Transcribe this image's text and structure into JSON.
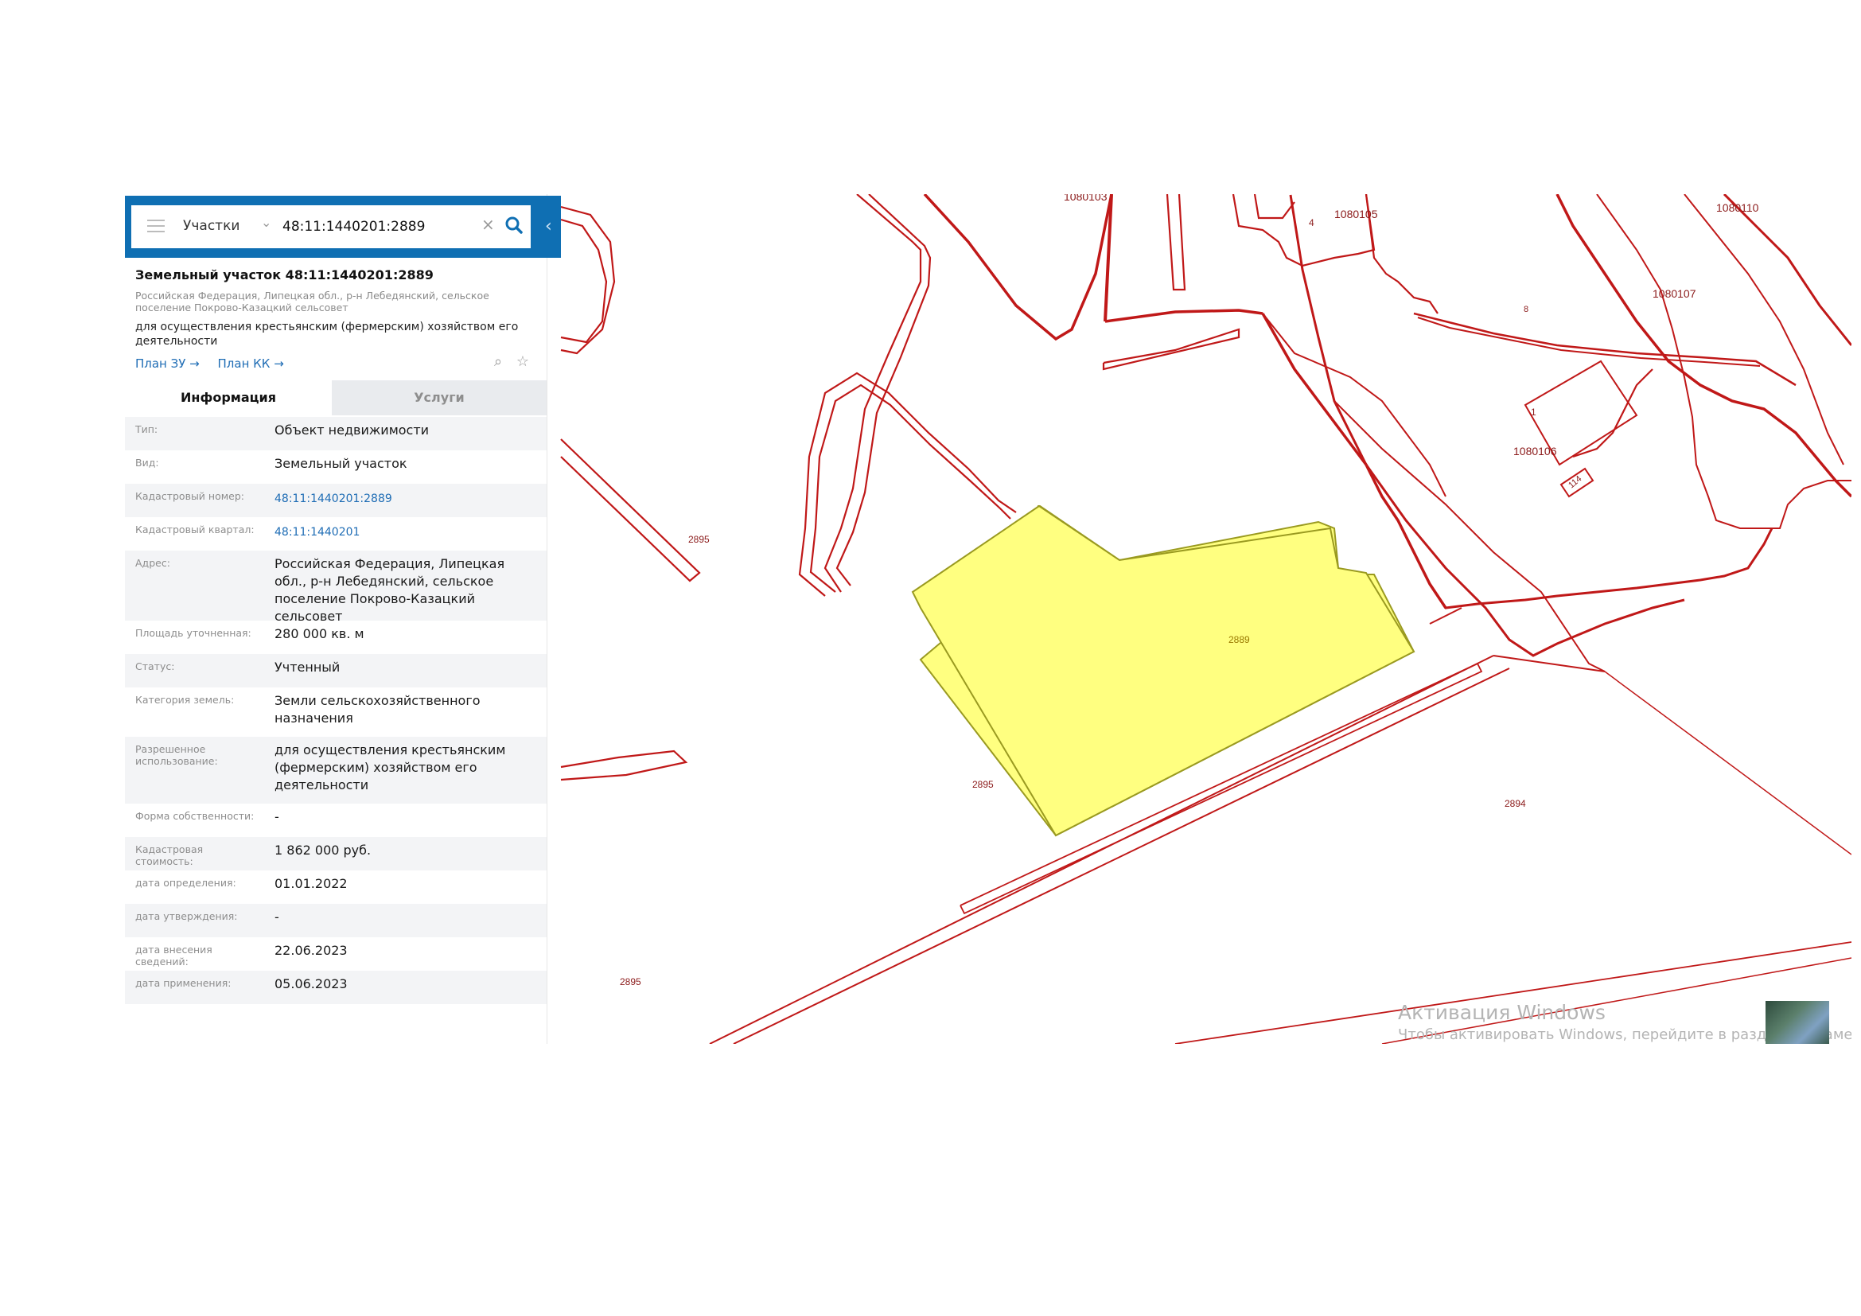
{
  "search": {
    "layer": "Участки",
    "query": "48:11:1440201:2889"
  },
  "parcel": {
    "title": "Земельный участок 48:11:1440201:2889",
    "address_short": "Российская Федерация, Липецкая обл., р-н Лебедянский, сельское поселение Покрово-Казацкий сельсовет",
    "purpose": "для осуществления крестьянским (фермерским) хозяйством его деятельности",
    "links": [
      "План ЗУ →",
      "План КК →"
    ]
  },
  "tabs": [
    "Информация",
    "Услуги"
  ],
  "info_rows": [
    {
      "key": "Тип:",
      "value": "Объект недвижимости"
    },
    {
      "key": "Вид:",
      "value": "Земельный участок"
    },
    {
      "key": "Кадастровый номер:",
      "value": "48:11:1440201:2889"
    },
    {
      "key": "Кадастровый квартал:",
      "value": "48:11:1440201"
    },
    {
      "key": "Адрес:",
      "value": "Российская Федерация, Липецкая обл., р-н Лебедянский, сельское поселение Покрово-Казацкий сельсовет"
    },
    {
      "key": "Площадь уточненная:",
      "value": "280 000 кв. м"
    },
    {
      "key": "Статус:",
      "value": "Учтенный"
    },
    {
      "key": "Категория земель:",
      "value": "Земли сельскохозяйственного назначения"
    },
    {
      "key": "Разрешенное использование:",
      "value": "для осуществления крестьянским (фермерским) хозяйством его деятельности"
    },
    {
      "key": "Форма собственности:",
      "value": "-"
    },
    {
      "key": "Кадастровая стоимость:",
      "value": "1 862 000 руб."
    },
    {
      "key": "дата определения:",
      "value": "01.01.2022"
    },
    {
      "key": "дата утверждения:",
      "value": "-"
    },
    {
      "key": "дата внесения сведений:",
      "value": "22.06.2023"
    },
    {
      "key": "дата применения:",
      "value": "05.06.2023"
    }
  ],
  "map": {
    "labels": [
      "1080103",
      "1080105",
      "1080110",
      "1080107",
      "1080106",
      "2895",
      "2889",
      "2894",
      "4",
      "1",
      "114",
      "8"
    ],
    "colors": {
      "boundary": "#c01818",
      "selected_fill": "#ffff80",
      "selected_stroke": "#9a9a20"
    }
  },
  "windows_activation": {
    "title": "Активация Windows",
    "subtitle": "Чтобы активировать Windows, перейдите в раздел \"Параметры\"."
  },
  "icons": [
    "menu-icon",
    "chevron-down-icon",
    "close-icon",
    "search-icon",
    "chevron-left-icon",
    "zoom-to-icon",
    "star-icon"
  ]
}
